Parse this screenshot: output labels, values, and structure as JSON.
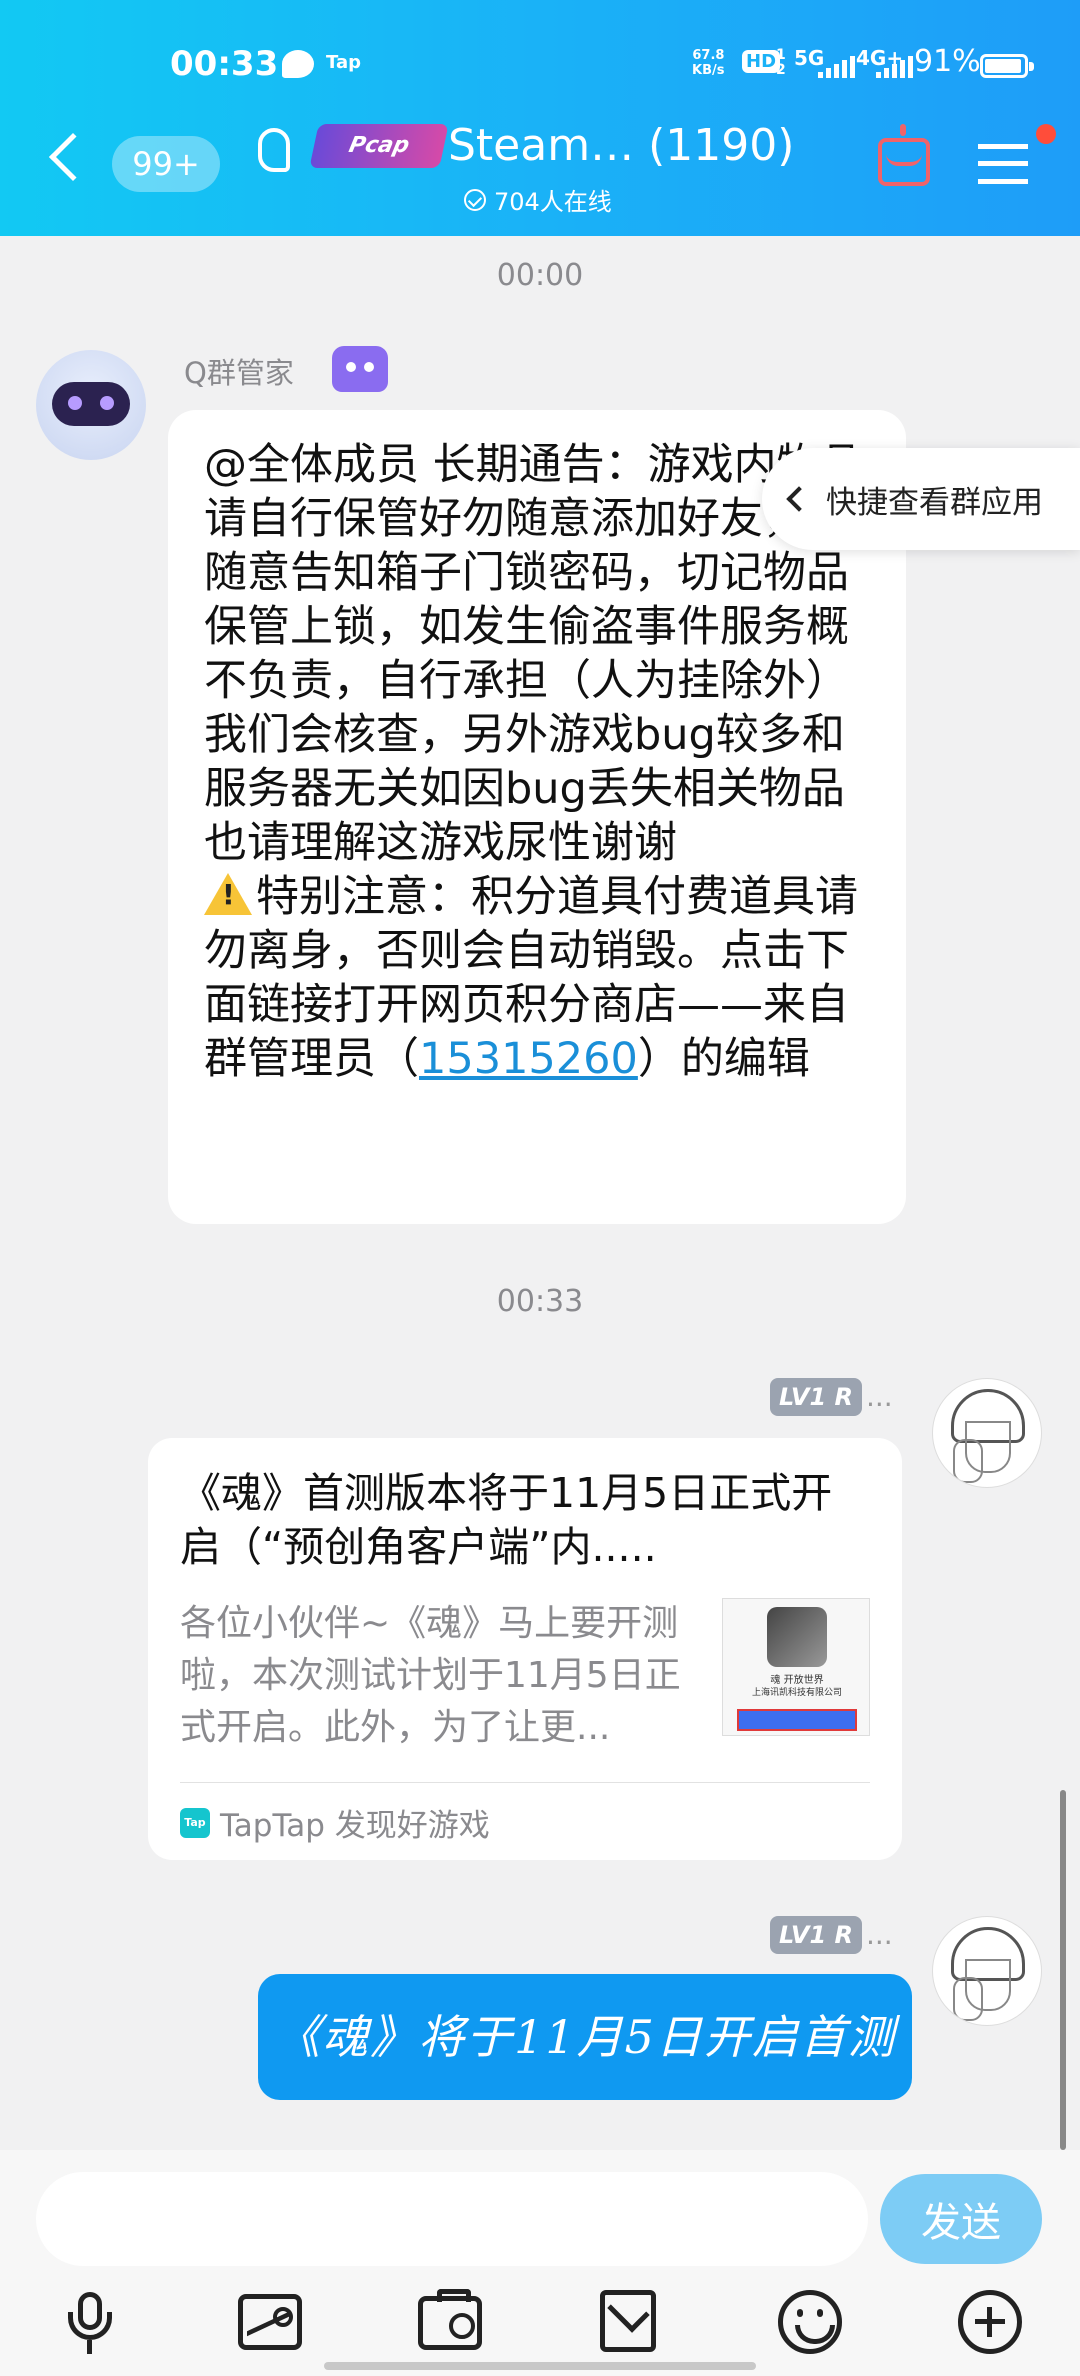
{
  "status_bar": {
    "time": "00:33",
    "app_tag": "Tap",
    "speed": "67.8",
    "speed_unit": "KB/s",
    "hd": "HD",
    "hd_sub": "1\n2",
    "net1": "5G",
    "net2": "4G+",
    "battery": "91%"
  },
  "header": {
    "unread_badge": "99+",
    "group_logo_text": "Pcap",
    "group_title": "Steam…  (1190)",
    "online_count": "704人在线"
  },
  "messages": {
    "time1": "00:00",
    "sender1": "Q群管家",
    "announce_text_1": "@全体成员 长期通告：游戏内物品请自行保管好勿随意添加好友，勿随意告知箱子门锁密码，切记物品保管上锁，如发生偷盗事件服务概不负责，自行承担（人为挂除外）我们会核查，另外游戏bug较多和服务器无关如因bug丢失相关物品也请理解这游戏尿性谢谢",
    "announce_text_2": "特别注意：积分道具付费道具请勿离身，否则会自动销毁。点击下面链接打开网页积分商店——来自群管理员（",
    "announce_link": "15315260",
    "announce_text_3": "）的编辑",
    "time2": "00:33",
    "level_badge": "LV1 R",
    "name_ellipsis": "...",
    "card_title": "《魂》首测版本将于11月5日正式开启（“预创角客户端”内.....",
    "card_desc": "各位小伙伴~《魂》马上要开测啦，本次测试计划于11月5日正式开启。此外，为了让更...",
    "card_thumb_line1": "魂 开放世界",
    "card_thumb_line2": "上海讯凯科技有限公司",
    "card_source": "TapTap 发现好游戏",
    "tap_icon_text": "Tap",
    "sent_text": "《魂》将于11月5日开启首测"
  },
  "quick_app": {
    "label": "快捷查看群应用"
  },
  "input": {
    "value": "",
    "placeholder": "",
    "send_label": "发送"
  },
  "icons": [
    "back-icon",
    "ear-icon",
    "cake-icon",
    "menu-icon",
    "robot-icon",
    "warning-icon",
    "mic-icon",
    "photo-icon",
    "camera-icon",
    "red-packet-icon",
    "emoji-icon",
    "plus-icon"
  ],
  "colors": {
    "header_start": "#12c9f3",
    "header_end": "#1e9df8",
    "sent_bubble": "#0f99f1",
    "link": "#1a8fd8",
    "send_button": "#7dccf5",
    "notify_dot": "#ff4d3a"
  }
}
